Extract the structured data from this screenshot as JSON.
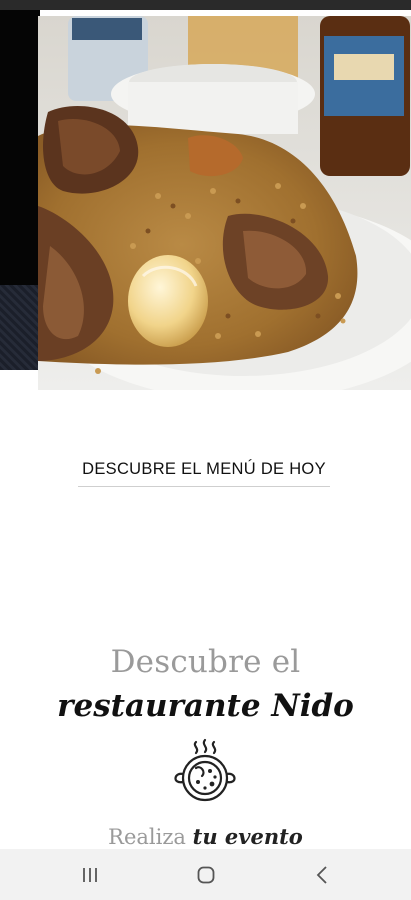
{
  "menu": {
    "link_label": "DESCUBRE EL MENÚ DE HOY"
  },
  "about": {
    "line1": "Descubre el",
    "line2": "restaurante Nido"
  },
  "event": {
    "prefix": "Realiza",
    "emphasis": "tu evento"
  },
  "icons": {
    "paella": "paella-pan-icon",
    "recents": "recent-apps-icon",
    "home": "home-icon",
    "back": "back-icon"
  },
  "colors": {
    "text_dark": "#111111",
    "text_gray": "#9a9a9a",
    "nav_bar": "#f2f2f2"
  }
}
